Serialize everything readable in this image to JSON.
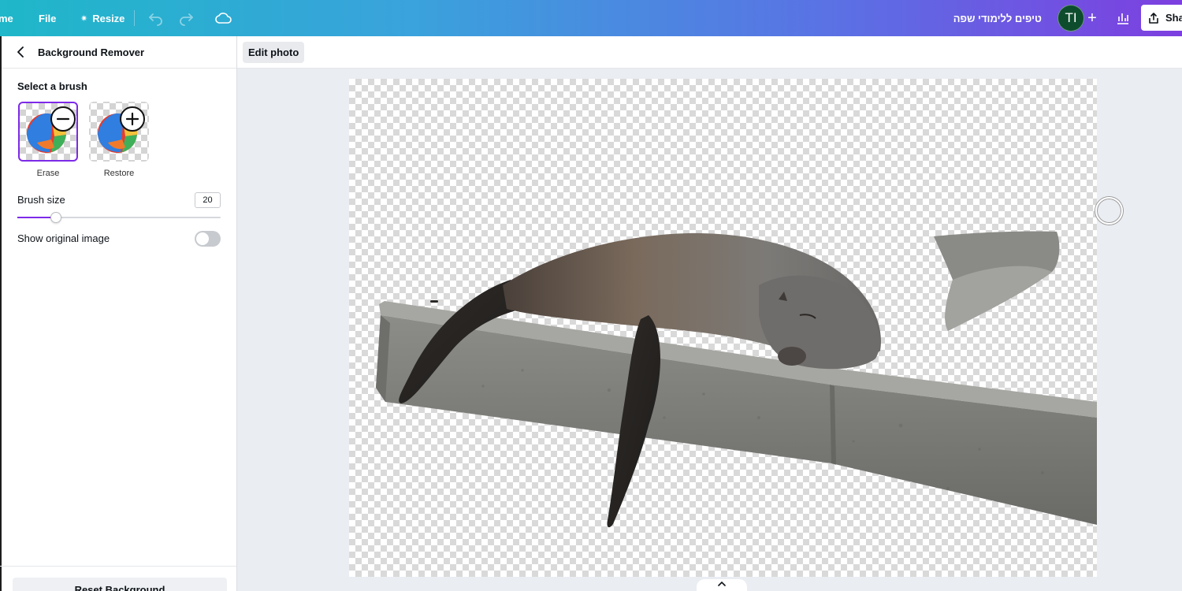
{
  "topbar": {
    "home_label": "me",
    "file_label": "File",
    "resize_label": "Resize",
    "project_name": "טיפים ללימודי שפה",
    "avatar_initials": "TI",
    "share_label": "Sha"
  },
  "panel": {
    "title": "Background Remover",
    "select_brush_label": "Select a brush",
    "brushes": [
      {
        "label": "Erase",
        "selected": true
      },
      {
        "label": "Restore",
        "selected": false
      }
    ],
    "brush_size_label": "Brush size",
    "brush_size_value": "20",
    "brush_size_level_fraction": 0.19,
    "show_original_label": "Show original image",
    "show_original_on": false,
    "reset_label": "Reset Background"
  },
  "editbar": {
    "edit_photo_label": "Edit photo"
  },
  "colors": {
    "accent": "#7d2ae8",
    "avatar_bg": "#0d4d2e"
  }
}
